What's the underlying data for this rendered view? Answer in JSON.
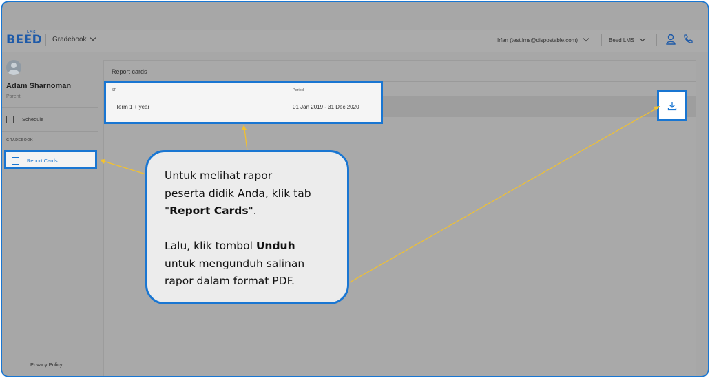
{
  "header": {
    "logo_text": "BEED",
    "logo_sub": "LMS",
    "module_dropdown": "Gradebook",
    "user_dropdown": "Irfan (test.lms@dispostable.com)",
    "institution_dropdown": "Beed LMS",
    "icons": [
      "user-icon",
      "phone-icon"
    ]
  },
  "sidebar": {
    "user_name": "Adam Sharnoman",
    "user_role": "Parent",
    "items": [
      {
        "label": "Schedule",
        "icon": "calendar-icon"
      }
    ],
    "section_label": "GRADEBOOK",
    "active_item": {
      "label": "Report Cards",
      "icon": "report-card-icon"
    },
    "footer_link": "Privacy Policy"
  },
  "main": {
    "card_title": "Report cards",
    "table": {
      "columns": [
        "SP",
        "Period"
      ],
      "rows": [
        {
          "sp": "Term 1 + year",
          "period": "01 Jan 2019 - 31 Dec 2020"
        }
      ]
    },
    "download_icon": "download-icon"
  },
  "callout": {
    "line1": "Untuk melihat rapor",
    "line2": "peserta didik Anda, klik tab",
    "line3_pre": "\"",
    "line3_bold": "Report Cards",
    "line3_post": "\".",
    "line4_pre": "Lalu, klik tombol ",
    "line4_bold": "Unduh",
    "line5": "untuk mengunduh salinan",
    "line6": "rapor dalam format PDF."
  },
  "colors": {
    "accent": "#1976d2",
    "overlay": "#a7a7a7",
    "arrow": "#f2c12e"
  }
}
